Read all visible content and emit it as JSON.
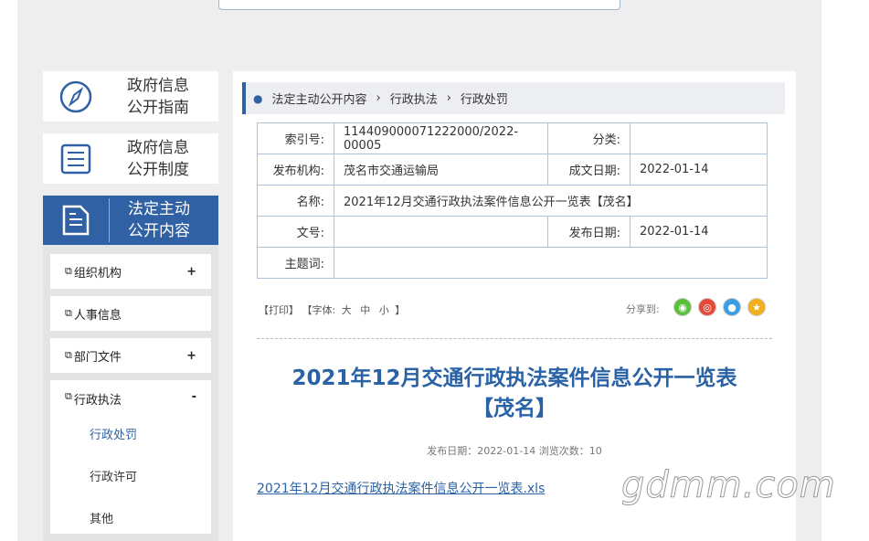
{
  "nav": {
    "items": [
      {
        "label_line1": "政府信息",
        "label_line2": "公开指南",
        "icon": "compass-icon"
      },
      {
        "label_line1": "政府信息",
        "label_line2": "公开制度",
        "icon": "list-doc-icon"
      },
      {
        "label_line1": "法定主动",
        "label_line2": "公开内容",
        "icon": "document-icon"
      }
    ],
    "sub": [
      {
        "label": "组织机构",
        "sign": "+"
      },
      {
        "label": "人事信息",
        "sign": ""
      },
      {
        "label": "部门文件",
        "sign": "+"
      },
      {
        "label": "行政执法",
        "sign": "-"
      }
    ],
    "leaves": [
      "行政处罚",
      "行政许可",
      "其他"
    ]
  },
  "breadcrumb": [
    "法定主动公开内容",
    "行政执法",
    "行政处罚"
  ],
  "meta": {
    "index_label": "索引号:",
    "index_value": "114409000071222000/2022-00005",
    "category_label": "分类:",
    "category_value": "",
    "publisher_label": "发布机构:",
    "publisher_value": "茂名市交通运输局",
    "created_label": "成文日期:",
    "created_value": "2022-01-14",
    "name_label": "名称:",
    "name_value": "2021年12月交通行政执法案件信息公开一览表【茂名】",
    "docno_label": "文号:",
    "docno_value": "",
    "pubdate_label": "发布日期:",
    "pubdate_value": "2022-01-14",
    "subject_label": "主题词:",
    "subject_value": ""
  },
  "tools": {
    "print": "【打印】",
    "font_label": "【字体:",
    "big": "大",
    "mid": "中",
    "small": "小",
    "close": "】"
  },
  "share_label": "分享到:",
  "share_icons": [
    {
      "name": "wechat-icon",
      "glyph": "◉",
      "color": "#5bbf3a"
    },
    {
      "name": "weibo-icon",
      "glyph": "◎",
      "color": "#e6493a"
    },
    {
      "name": "qq-icon",
      "glyph": "●",
      "color": "#3a9ee6"
    },
    {
      "name": "qzone-icon",
      "glyph": "★",
      "color": "#f2b01e"
    }
  ],
  "article": {
    "title_line1": "2021年12月交通行政执法案件信息公开一览表",
    "title_line2": "【茂名】",
    "pub_info": "发布日期：2022-01-14  浏览次数：10",
    "attachment": "2021年12月交通行政执法案件信息公开一览表.xls"
  },
  "watermark": "gdmm.com"
}
